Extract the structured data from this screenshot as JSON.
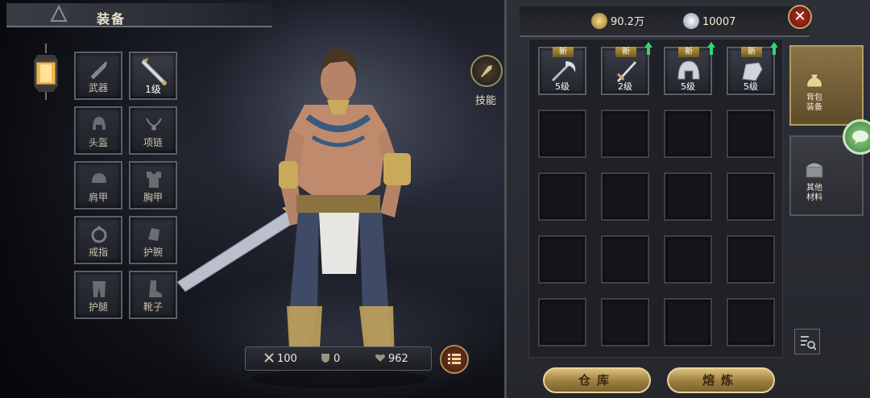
{
  "header": {
    "title": "装备"
  },
  "equip_slots": [
    {
      "label": "武器",
      "icon": "sword-icon"
    },
    {
      "label": "1级",
      "icon": "weapon-item-icon",
      "filled": true
    },
    {
      "label": "头盔",
      "icon": "helmet-icon"
    },
    {
      "label": "项链",
      "icon": "necklace-icon"
    },
    {
      "label": "肩甲",
      "icon": "shoulder-armor-icon"
    },
    {
      "label": "胸甲",
      "icon": "chest-armor-icon"
    },
    {
      "label": "戒指",
      "icon": "ring-icon"
    },
    {
      "label": "护腕",
      "icon": "bracer-icon"
    },
    {
      "label": "护腿",
      "icon": "leggings-icon"
    },
    {
      "label": "靴子",
      "icon": "boots-icon"
    }
  ],
  "skill": {
    "label": "技能"
  },
  "stats": {
    "attack": "100",
    "defense": "0",
    "health": "962"
  },
  "currency": {
    "gold": "90.2万",
    "diamond": "10007"
  },
  "inventory": {
    "items": [
      {
        "tag": "新",
        "level": "5级",
        "icon": "scythe-icon"
      },
      {
        "tag": "新",
        "level": "2级",
        "icon": "sword-item-icon"
      },
      {
        "tag": "新",
        "level": "5级",
        "icon": "helmet-item-icon"
      },
      {
        "tag": "新",
        "level": "5级",
        "icon": "gauntlet-item-icon"
      }
    ]
  },
  "side_tabs": [
    {
      "label": "背包装备",
      "icon": "bag-icon",
      "active": true
    },
    {
      "label": "其他材料",
      "icon": "chest-icon",
      "active": false
    }
  ],
  "buttons": {
    "warehouse": "仓库",
    "smelt": "熔炼"
  },
  "colors": {
    "accent_gold": "#c9a95c",
    "close_red": "#b3331f",
    "new_tag": "#b8983e",
    "upgrade_green": "#3ad07a"
  }
}
